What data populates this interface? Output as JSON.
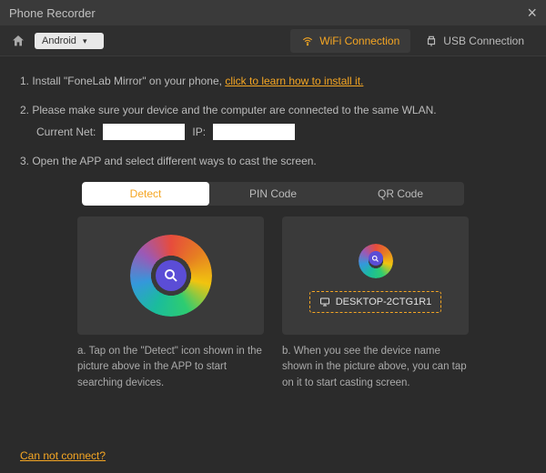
{
  "title": "Phone Recorder",
  "platform": "Android",
  "conn": {
    "wifi": "WiFi Connection",
    "usb": "USB Connection"
  },
  "steps": {
    "s1_prefix": "1. Install \"FoneLab Mirror\" on your phone, ",
    "s1_link": "click to learn how to install it.",
    "s2": "2. Please make sure your device and the computer are connected to the same WLAN.",
    "current_net_label": "Current Net:",
    "current_net_value": "",
    "ip_label": "IP:",
    "ip_value": "",
    "s3": "3. Open the APP and select different ways to cast the screen."
  },
  "tabs": {
    "detect": "Detect",
    "pin": "PIN Code",
    "qr": "QR Code"
  },
  "panelA": {
    "caption": "a. Tap on the \"Detect\" icon shown in the picture above in the APP to start searching devices."
  },
  "panelB": {
    "device": "DESKTOP-2CTG1R1",
    "caption": "b. When you see the device name shown in the picture above, you can tap on it to start casting screen."
  },
  "footer_link": "Can not connect?"
}
